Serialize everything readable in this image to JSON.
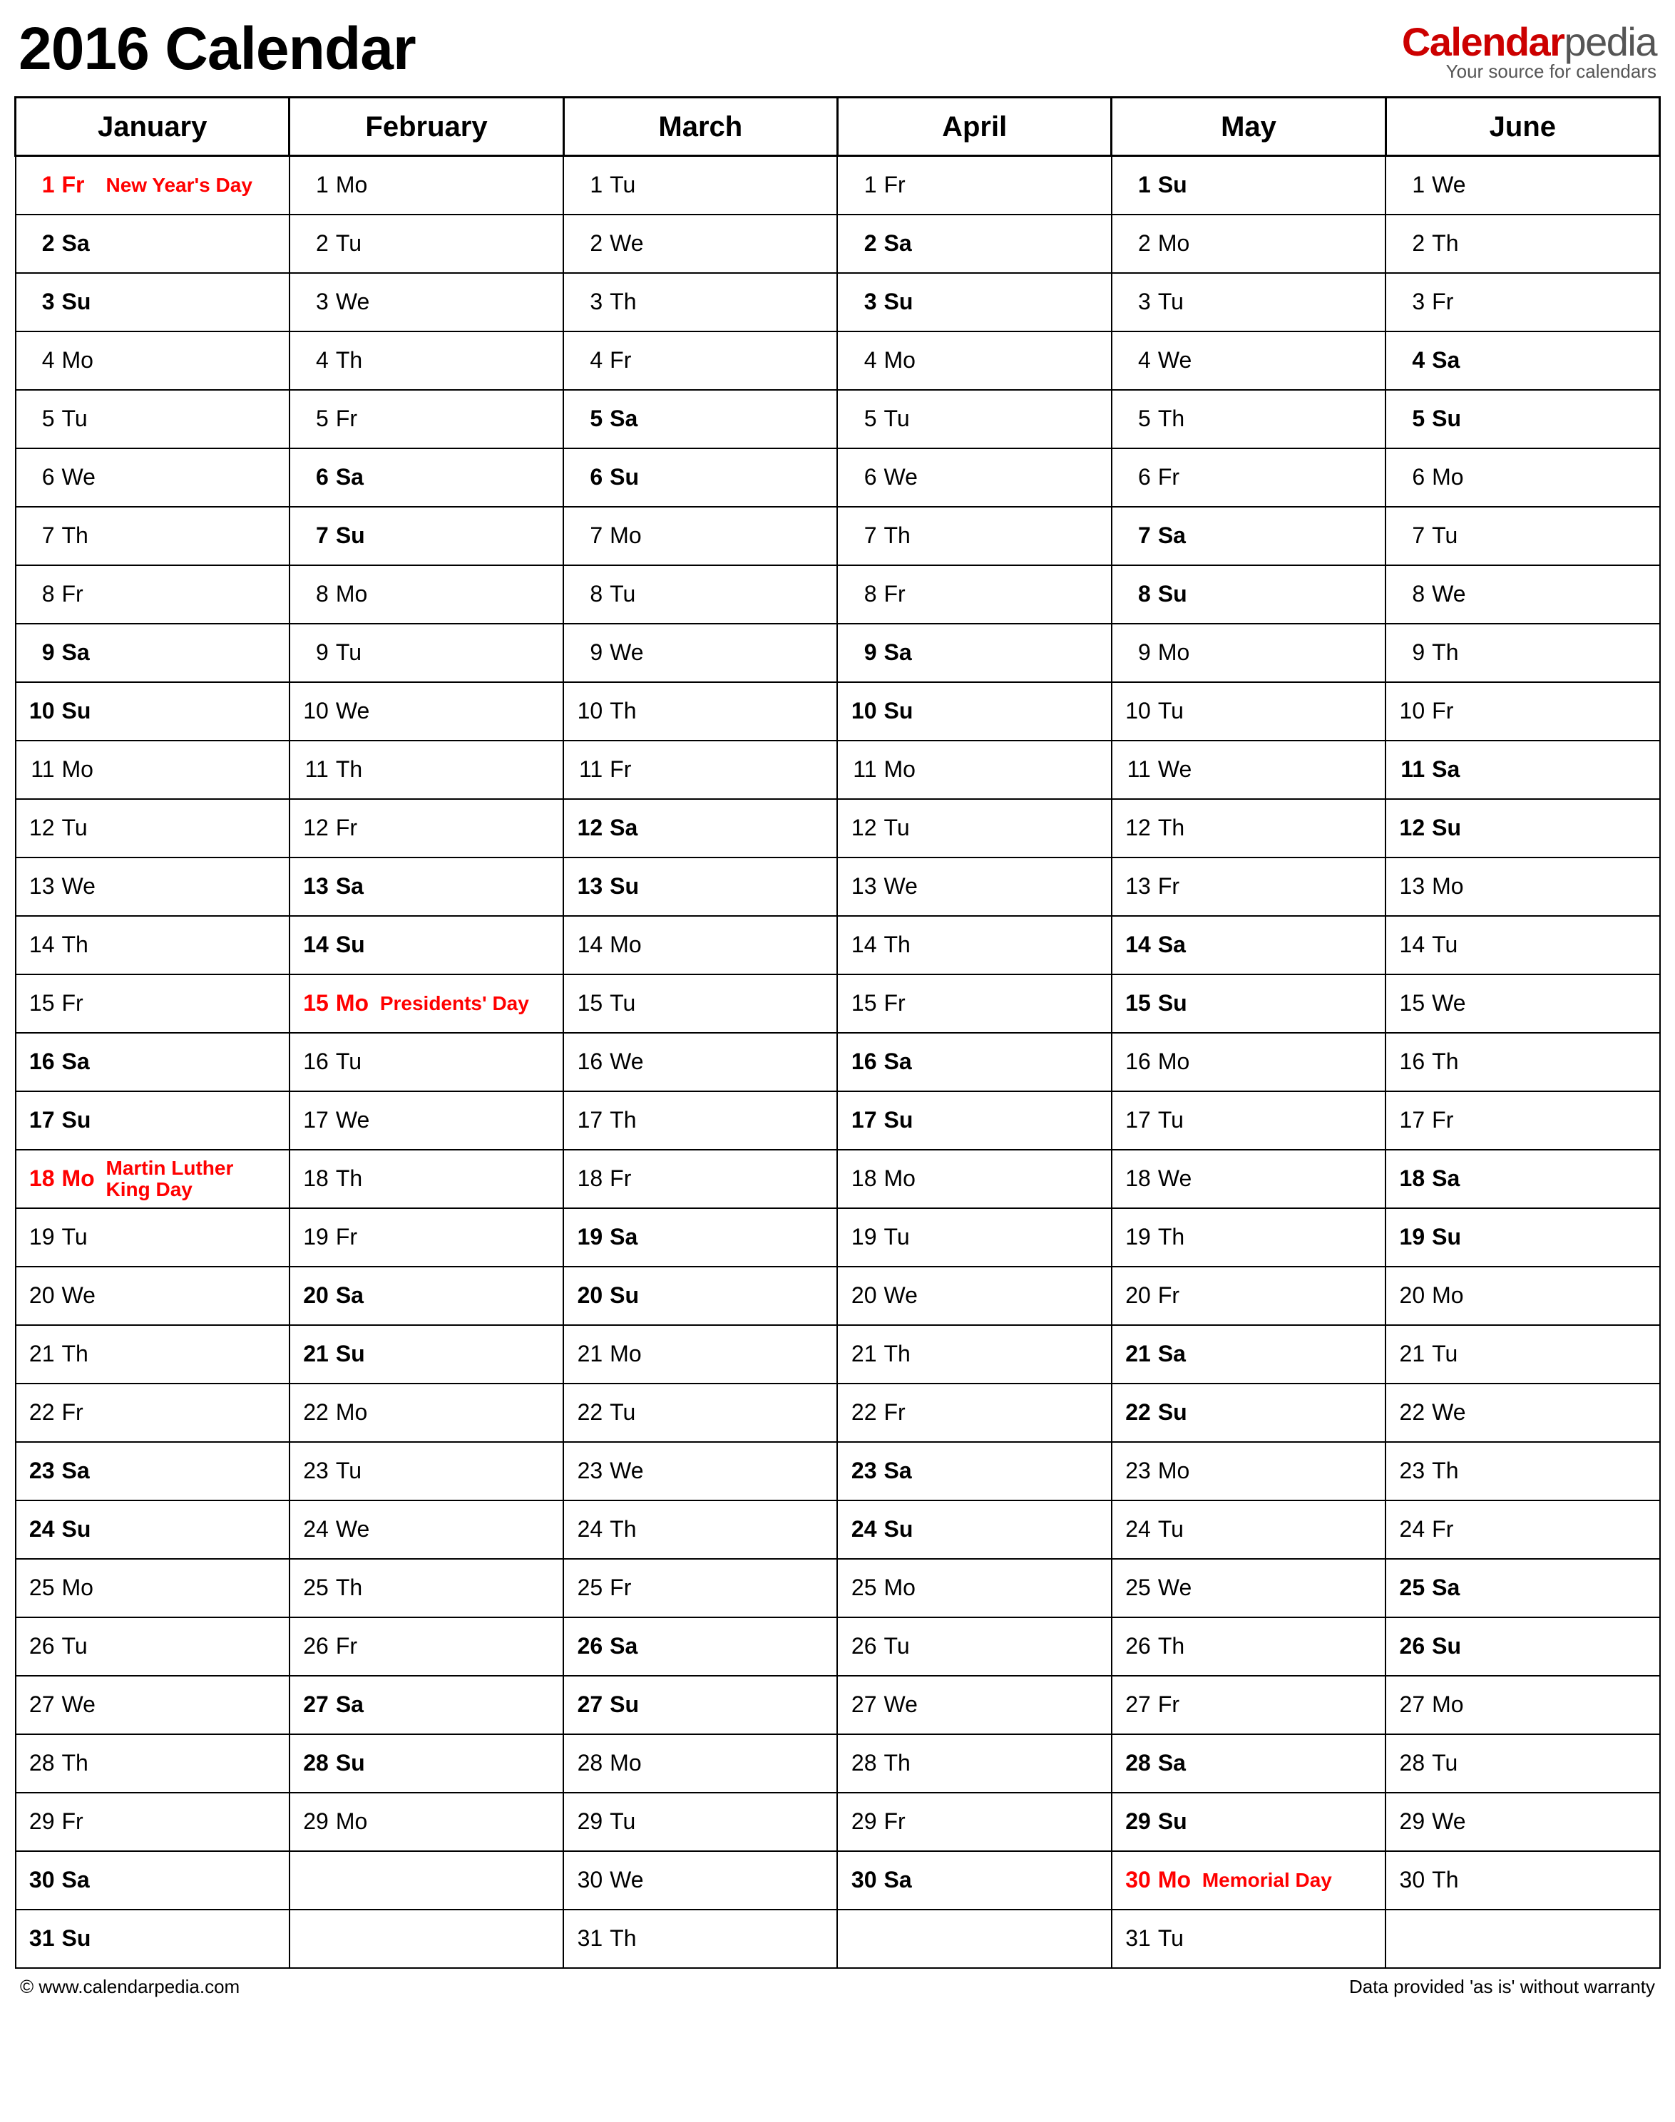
{
  "title": "2016 Calendar",
  "brand": {
    "part1": "Calendar",
    "part2": "pedia",
    "tagline": "Your source for calendars"
  },
  "footer": {
    "left": "© www.calendarpedia.com",
    "right": "Data provided 'as is' without warranty"
  },
  "months": [
    "January",
    "February",
    "March",
    "April",
    "May",
    "June"
  ],
  "weekdays": [
    "Su",
    "Mo",
    "Tu",
    "We",
    "Th",
    "Fr",
    "Sa"
  ],
  "startDow": [
    5,
    1,
    2,
    5,
    0,
    3
  ],
  "daysInMonth": [
    31,
    29,
    31,
    30,
    31,
    30
  ],
  "holidays": {
    "0": {
      "1": "New Year's Day",
      "18": "Martin Luther King Day"
    },
    "1": {
      "15": "Presidents' Day"
    },
    "4": {
      "30": "Memorial Day"
    }
  },
  "rows": 31
}
